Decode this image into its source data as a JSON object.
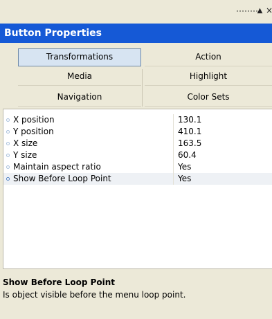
{
  "panel": {
    "title": "Button Properties"
  },
  "tabs": [
    {
      "label": "Transformations",
      "selected": true
    },
    {
      "label": "Action",
      "selected": false
    },
    {
      "label": "Media",
      "selected": false
    },
    {
      "label": "Highlight",
      "selected": false
    },
    {
      "label": "Navigation",
      "selected": false
    },
    {
      "label": "Color Sets",
      "selected": false
    }
  ],
  "properties": [
    {
      "name": "X position",
      "value": "130.1"
    },
    {
      "name": "Y position",
      "value": "410.1"
    },
    {
      "name": "X size",
      "value": "163.5"
    },
    {
      "name": "Y size",
      "value": "60.4"
    },
    {
      "name": "Maintain aspect ratio",
      "value": "Yes"
    },
    {
      "name": "Show Before Loop Point",
      "value": "Yes"
    }
  ],
  "selected_property": "Show Before Loop Point",
  "description": {
    "title": "Show Before Loop Point",
    "text": "Is object visible before the menu loop point."
  },
  "window_controls": {
    "pin_glyph": "▲",
    "close_glyph": "×"
  },
  "colors": {
    "title_bar": "#1559d6",
    "selected_tab": "#d7e4f2",
    "panel_bg": "#ece9d8"
  }
}
